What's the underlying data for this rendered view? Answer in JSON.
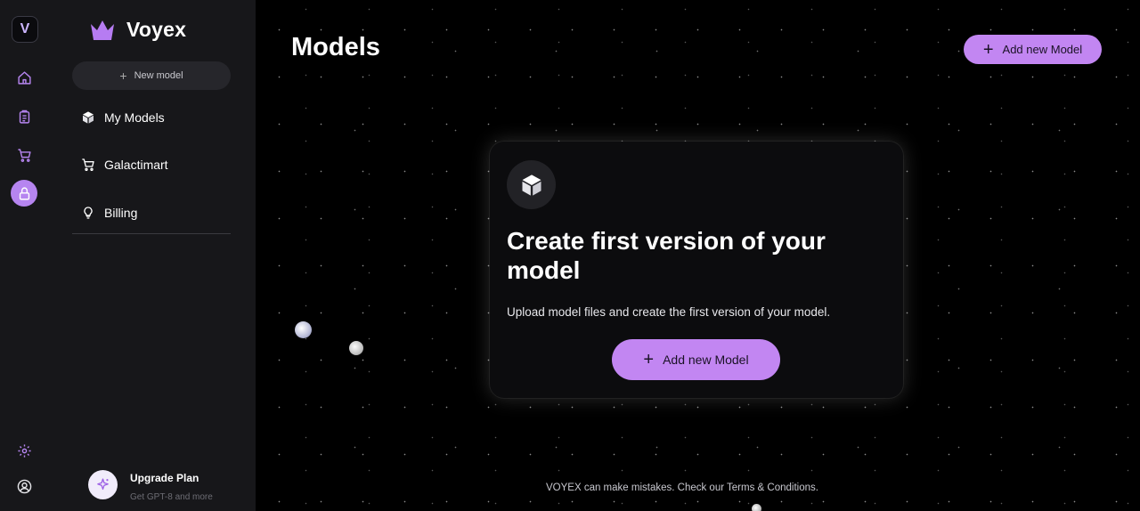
{
  "rail": {
    "logo_letter": "V",
    "items": [
      {
        "icon": "home-icon"
      },
      {
        "icon": "clipboard-icon"
      },
      {
        "icon": "cart-icon"
      },
      {
        "icon": "lock-icon",
        "active": true
      }
    ],
    "bottom": [
      {
        "icon": "gear-icon"
      },
      {
        "icon": "user-icon"
      }
    ]
  },
  "sidebar": {
    "brand": "Voyex",
    "new_model_label": "New model",
    "nav": [
      {
        "label": "My Models",
        "icon": "cube-icon"
      },
      {
        "label": "Galactimart",
        "icon": "cart-icon"
      },
      {
        "label": "Billing",
        "icon": "lightbulb-icon"
      }
    ],
    "upgrade": {
      "title": "Upgrade Plan",
      "subtitle": "Get GPT-8 and more"
    }
  },
  "main": {
    "title": "Models",
    "add_button_label": "Add new Model",
    "card": {
      "title": "Create first version of your model",
      "description": "Upload model files and create the first version of your model.",
      "button_label": "Add new Model"
    },
    "footer": "VOYEX can make mistakes. Check our Terms & Conditions."
  },
  "colors": {
    "accent": "#c286f2",
    "sidebar_bg": "#17171a",
    "main_bg": "#000000",
    "card_bg": "#0c0c0e"
  }
}
